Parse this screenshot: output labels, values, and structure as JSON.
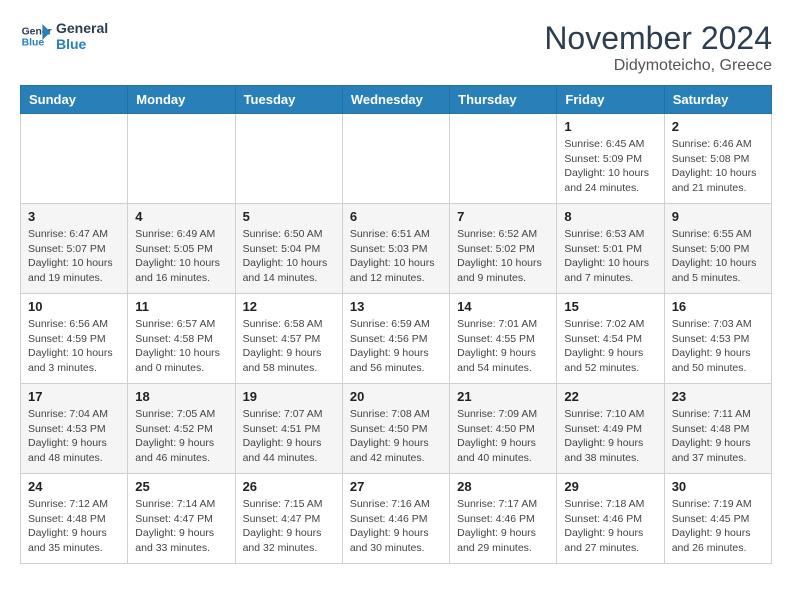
{
  "logo": {
    "line1": "General",
    "line2": "Blue"
  },
  "title": "November 2024",
  "location": "Didymoteicho, Greece",
  "weekdays": [
    "Sunday",
    "Monday",
    "Tuesday",
    "Wednesday",
    "Thursday",
    "Friday",
    "Saturday"
  ],
  "weeks": [
    [
      {
        "day": "",
        "info": ""
      },
      {
        "day": "",
        "info": ""
      },
      {
        "day": "",
        "info": ""
      },
      {
        "day": "",
        "info": ""
      },
      {
        "day": "",
        "info": ""
      },
      {
        "day": "1",
        "info": "Sunrise: 6:45 AM\nSunset: 5:09 PM\nDaylight: 10 hours\nand 24 minutes."
      },
      {
        "day": "2",
        "info": "Sunrise: 6:46 AM\nSunset: 5:08 PM\nDaylight: 10 hours\nand 21 minutes."
      }
    ],
    [
      {
        "day": "3",
        "info": "Sunrise: 6:47 AM\nSunset: 5:07 PM\nDaylight: 10 hours\nand 19 minutes."
      },
      {
        "day": "4",
        "info": "Sunrise: 6:49 AM\nSunset: 5:05 PM\nDaylight: 10 hours\nand 16 minutes."
      },
      {
        "day": "5",
        "info": "Sunrise: 6:50 AM\nSunset: 5:04 PM\nDaylight: 10 hours\nand 14 minutes."
      },
      {
        "day": "6",
        "info": "Sunrise: 6:51 AM\nSunset: 5:03 PM\nDaylight: 10 hours\nand 12 minutes."
      },
      {
        "day": "7",
        "info": "Sunrise: 6:52 AM\nSunset: 5:02 PM\nDaylight: 10 hours\nand 9 minutes."
      },
      {
        "day": "8",
        "info": "Sunrise: 6:53 AM\nSunset: 5:01 PM\nDaylight: 10 hours\nand 7 minutes."
      },
      {
        "day": "9",
        "info": "Sunrise: 6:55 AM\nSunset: 5:00 PM\nDaylight: 10 hours\nand 5 minutes."
      }
    ],
    [
      {
        "day": "10",
        "info": "Sunrise: 6:56 AM\nSunset: 4:59 PM\nDaylight: 10 hours\nand 3 minutes."
      },
      {
        "day": "11",
        "info": "Sunrise: 6:57 AM\nSunset: 4:58 PM\nDaylight: 10 hours\nand 0 minutes."
      },
      {
        "day": "12",
        "info": "Sunrise: 6:58 AM\nSunset: 4:57 PM\nDaylight: 9 hours\nand 58 minutes."
      },
      {
        "day": "13",
        "info": "Sunrise: 6:59 AM\nSunset: 4:56 PM\nDaylight: 9 hours\nand 56 minutes."
      },
      {
        "day": "14",
        "info": "Sunrise: 7:01 AM\nSunset: 4:55 PM\nDaylight: 9 hours\nand 54 minutes."
      },
      {
        "day": "15",
        "info": "Sunrise: 7:02 AM\nSunset: 4:54 PM\nDaylight: 9 hours\nand 52 minutes."
      },
      {
        "day": "16",
        "info": "Sunrise: 7:03 AM\nSunset: 4:53 PM\nDaylight: 9 hours\nand 50 minutes."
      }
    ],
    [
      {
        "day": "17",
        "info": "Sunrise: 7:04 AM\nSunset: 4:53 PM\nDaylight: 9 hours\nand 48 minutes."
      },
      {
        "day": "18",
        "info": "Sunrise: 7:05 AM\nSunset: 4:52 PM\nDaylight: 9 hours\nand 46 minutes."
      },
      {
        "day": "19",
        "info": "Sunrise: 7:07 AM\nSunset: 4:51 PM\nDaylight: 9 hours\nand 44 minutes."
      },
      {
        "day": "20",
        "info": "Sunrise: 7:08 AM\nSunset: 4:50 PM\nDaylight: 9 hours\nand 42 minutes."
      },
      {
        "day": "21",
        "info": "Sunrise: 7:09 AM\nSunset: 4:50 PM\nDaylight: 9 hours\nand 40 minutes."
      },
      {
        "day": "22",
        "info": "Sunrise: 7:10 AM\nSunset: 4:49 PM\nDaylight: 9 hours\nand 38 minutes."
      },
      {
        "day": "23",
        "info": "Sunrise: 7:11 AM\nSunset: 4:48 PM\nDaylight: 9 hours\nand 37 minutes."
      }
    ],
    [
      {
        "day": "24",
        "info": "Sunrise: 7:12 AM\nSunset: 4:48 PM\nDaylight: 9 hours\nand 35 minutes."
      },
      {
        "day": "25",
        "info": "Sunrise: 7:14 AM\nSunset: 4:47 PM\nDaylight: 9 hours\nand 33 minutes."
      },
      {
        "day": "26",
        "info": "Sunrise: 7:15 AM\nSunset: 4:47 PM\nDaylight: 9 hours\nand 32 minutes."
      },
      {
        "day": "27",
        "info": "Sunrise: 7:16 AM\nSunset: 4:46 PM\nDaylight: 9 hours\nand 30 minutes."
      },
      {
        "day": "28",
        "info": "Sunrise: 7:17 AM\nSunset: 4:46 PM\nDaylight: 9 hours\nand 29 minutes."
      },
      {
        "day": "29",
        "info": "Sunrise: 7:18 AM\nSunset: 4:46 PM\nDaylight: 9 hours\nand 27 minutes."
      },
      {
        "day": "30",
        "info": "Sunrise: 7:19 AM\nSunset: 4:45 PM\nDaylight: 9 hours\nand 26 minutes."
      }
    ]
  ]
}
